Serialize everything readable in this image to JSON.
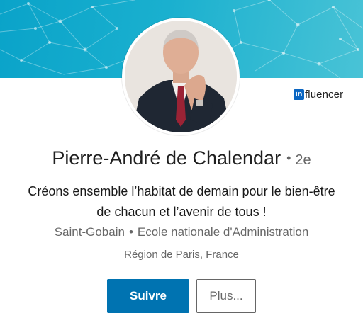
{
  "profile": {
    "name": "Pierre-André de Chalendar",
    "separator": "•",
    "degree": "2e",
    "headline_line1": "Créons ensemble l’habitat de demain pour le bien-être",
    "headline_line2": "de chacun et l’avenir de tous !",
    "company": "Saint-Gobain",
    "meta_separator": "•",
    "school": "Ecole nationale d'Administration",
    "location": "Région de Paris, France"
  },
  "badge": {
    "in_text": "in",
    "word": "fluencer",
    "color": "#0a66c2"
  },
  "actions": {
    "follow_label": "Suivre",
    "more_label": "Plus..."
  },
  "colors": {
    "banner": "#1ab0cf",
    "primary_button": "#0073b1"
  }
}
